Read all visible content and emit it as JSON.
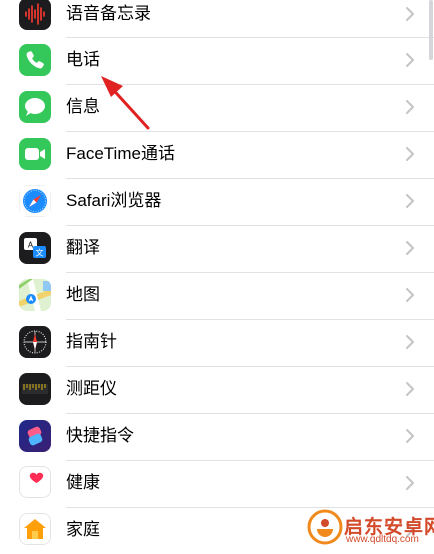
{
  "settings_list": {
    "items": [
      {
        "id": "voice-memos",
        "label": "语音备忘录",
        "icon": "voice-memos-icon"
      },
      {
        "id": "phone",
        "label": "电话",
        "icon": "phone-icon"
      },
      {
        "id": "messages",
        "label": "信息",
        "icon": "messages-icon"
      },
      {
        "id": "facetime",
        "label": "FaceTime通话",
        "icon": "facetime-icon"
      },
      {
        "id": "safari",
        "label": "Safari浏览器",
        "icon": "safari-icon"
      },
      {
        "id": "translate",
        "label": "翻译",
        "icon": "translate-icon"
      },
      {
        "id": "maps",
        "label": "地图",
        "icon": "maps-icon"
      },
      {
        "id": "compass",
        "label": "指南针",
        "icon": "compass-icon"
      },
      {
        "id": "measure",
        "label": "测距仪",
        "icon": "measure-icon"
      },
      {
        "id": "shortcuts",
        "label": "快捷指令",
        "icon": "shortcuts-icon"
      },
      {
        "id": "health",
        "label": "健康",
        "icon": "health-icon"
      },
      {
        "id": "home",
        "label": "家庭",
        "icon": "home-icon"
      }
    ]
  },
  "annotation": {
    "target": "phone",
    "color": "#e02222"
  },
  "watermark": {
    "title": "启东安卓网",
    "url": "www.qdltdq.com"
  },
  "colors": {
    "phone": "#34c759",
    "messages": "#34c759",
    "facetime": "#34c759",
    "chevron": "#c4c4c7",
    "separator": "#e2e2e6"
  }
}
